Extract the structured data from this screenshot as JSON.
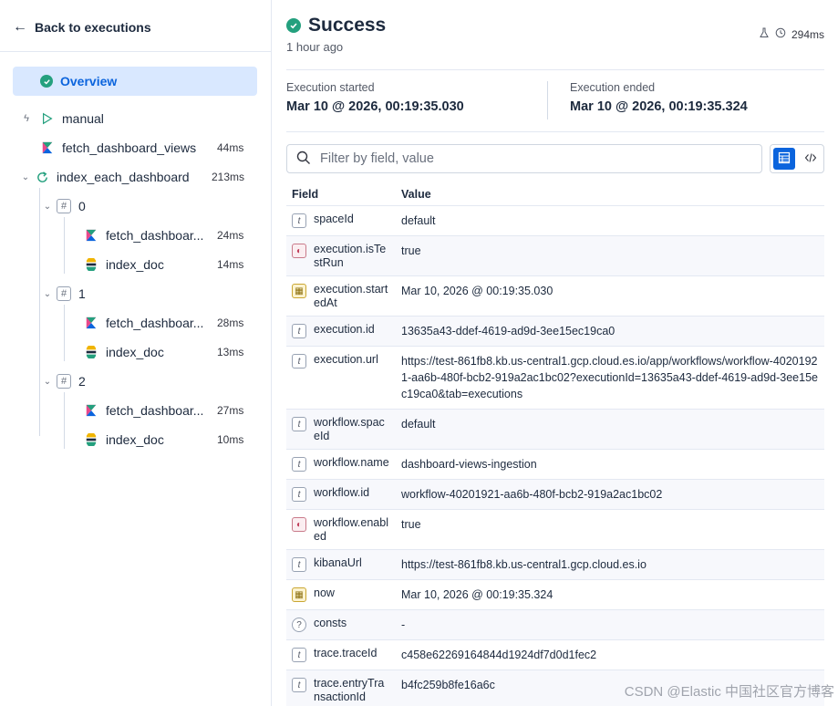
{
  "nav": {
    "back_label": "Back to executions"
  },
  "tree": {
    "overview_label": "Overview",
    "items": [
      {
        "label": "manual",
        "duration": ""
      },
      {
        "label": "fetch_dashboard_views",
        "duration": "44ms"
      },
      {
        "label": "index_each_dashboard",
        "duration": "213ms"
      },
      {
        "label": "0",
        "duration": ""
      },
      {
        "label": "fetch_dashboar...",
        "duration": "24ms"
      },
      {
        "label": "index_doc",
        "duration": "14ms"
      },
      {
        "label": "1",
        "duration": ""
      },
      {
        "label": "fetch_dashboar...",
        "duration": "28ms"
      },
      {
        "label": "index_doc",
        "duration": "13ms"
      },
      {
        "label": "2",
        "duration": ""
      },
      {
        "label": "fetch_dashboar...",
        "duration": "27ms"
      },
      {
        "label": "index_doc",
        "duration": "10ms"
      }
    ]
  },
  "header": {
    "status": "Success",
    "ago": "1 hour ago",
    "duration": "294ms",
    "status_color": "#24a07e"
  },
  "times": {
    "started_label": "Execution started",
    "started_value": "Mar 10 @ 2026, 00:19:35.030",
    "ended_label": "Execution ended",
    "ended_value": "Mar 10 @ 2026, 00:19:35.324"
  },
  "search": {
    "placeholder": "Filter by field, value"
  },
  "table": {
    "headers": {
      "field": "Field",
      "value": "Value"
    },
    "rows": [
      {
        "type": "t",
        "field": "spaceId",
        "value": "default"
      },
      {
        "type": "bool",
        "field": "execution.isTestRun",
        "value": "true"
      },
      {
        "type": "date",
        "field": "execution.startedAt",
        "value": "Mar 10, 2026 @ 00:19:35.030"
      },
      {
        "type": "t",
        "field": "execution.id",
        "value": "13635a43-ddef-4619-ad9d-3ee15ec19ca0"
      },
      {
        "type": "t",
        "field": "execution.url",
        "value": "https://test-861fb8.kb.us-central1.gcp.cloud.es.io/app/workflows/workflow-40201921-aa6b-480f-bcb2-919a2ac1bc02?executionId=13635a43-ddef-4619-ad9d-3ee15ec19ca0&tab=executions"
      },
      {
        "type": "t",
        "field": "workflow.spaceId",
        "value": "default"
      },
      {
        "type": "t",
        "field": "workflow.name",
        "value": "dashboard-views-ingestion"
      },
      {
        "type": "t",
        "field": "workflow.id",
        "value": "workflow-40201921-aa6b-480f-bcb2-919a2ac1bc02"
      },
      {
        "type": "bool",
        "field": "workflow.enabled",
        "value": "true"
      },
      {
        "type": "t",
        "field": "kibanaUrl",
        "value": "https://test-861fb8.kb.us-central1.gcp.cloud.es.io"
      },
      {
        "type": "date",
        "field": "now",
        "value": "Mar 10, 2026 @ 00:19:35.324"
      },
      {
        "type": "nul",
        "field": "consts",
        "value": "-"
      },
      {
        "type": "t",
        "field": "trace.traceId",
        "value": "c458e62269164844d1924df7d0d1fec2"
      },
      {
        "type": "t",
        "field": "trace.entryTransactionId",
        "value": "b4fc259b8fe16a6c"
      }
    ]
  },
  "watermark": "CSDN @Elastic 中国社区官方博客"
}
